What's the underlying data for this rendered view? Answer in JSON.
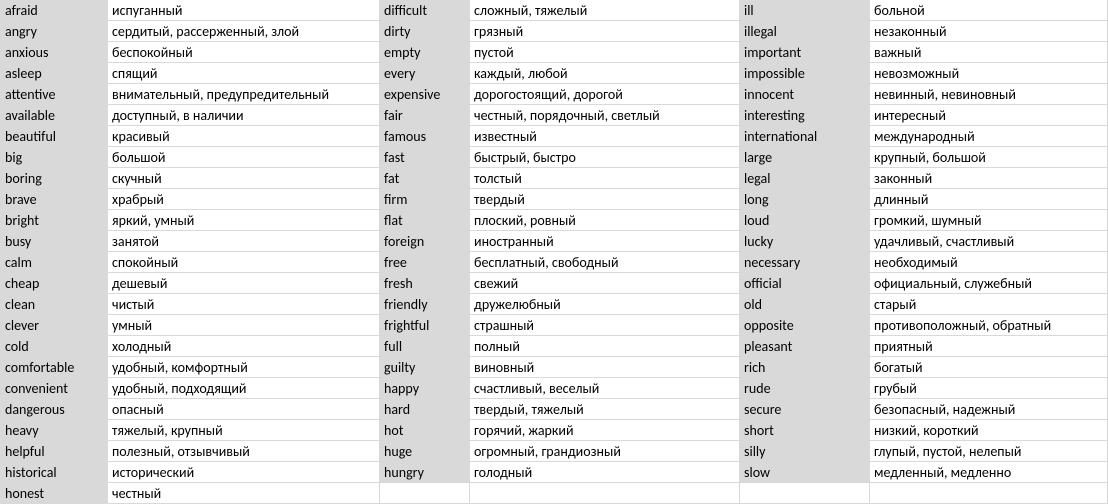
{
  "columns": [
    {
      "rows": [
        {
          "en": "afraid",
          "ru": "испуганный"
        },
        {
          "en": "angry",
          "ru": "сердитый, рассерженный, злой"
        },
        {
          "en": "anxious",
          "ru": "беспокойный"
        },
        {
          "en": "asleep",
          "ru": "спящий"
        },
        {
          "en": "attentive",
          "ru": "внимательный, предупредительный"
        },
        {
          "en": "available",
          "ru": "доступный, в наличии"
        },
        {
          "en": "beautiful",
          "ru": "красивый"
        },
        {
          "en": "big",
          "ru": "большой"
        },
        {
          "en": "boring",
          "ru": "скучный"
        },
        {
          "en": "brave",
          "ru": "храбрый"
        },
        {
          "en": "bright",
          "ru": "яркий, умный"
        },
        {
          "en": "busy",
          "ru": "занятой"
        },
        {
          "en": "calm",
          "ru": "спокойный"
        },
        {
          "en": "cheap",
          "ru": "дешевый"
        },
        {
          "en": "clean",
          "ru": "чистый"
        },
        {
          "en": "clever",
          "ru": "умный"
        },
        {
          "en": "cold",
          "ru": "холодный"
        },
        {
          "en": "comfortable",
          "ru": "удобный, комфортный"
        },
        {
          "en": "convenient",
          "ru": "удобный, подходящий"
        },
        {
          "en": "dangerous",
          "ru": "опасный"
        },
        {
          "en": "heavy",
          "ru": "тяжелый, крупный"
        },
        {
          "en": "helpful",
          "ru": "полезный, отзывчивый"
        },
        {
          "en": "historical",
          "ru": "исторический"
        },
        {
          "en": "honest",
          "ru": "честный"
        }
      ]
    },
    {
      "rows": [
        {
          "en": "difficult",
          "ru": "сложный, тяжелый"
        },
        {
          "en": "dirty",
          "ru": "грязный"
        },
        {
          "en": "empty",
          "ru": "пустой"
        },
        {
          "en": "every",
          "ru": "каждый, любой"
        },
        {
          "en": "expensive",
          "ru": "дорогостоящий, дорогой"
        },
        {
          "en": "fair",
          "ru": "честный, порядочный, светлый"
        },
        {
          "en": "famous",
          "ru": "известный"
        },
        {
          "en": "fast",
          "ru": "быстрый, быстро"
        },
        {
          "en": "fat",
          "ru": "толстый"
        },
        {
          "en": "firm",
          "ru": "твердый"
        },
        {
          "en": "flat",
          "ru": "плоский, ровный"
        },
        {
          "en": "foreign",
          "ru": "иностранный"
        },
        {
          "en": "free",
          "ru": "бесплатный, свободный"
        },
        {
          "en": "fresh",
          "ru": "свежий"
        },
        {
          "en": "friendly",
          "ru": "дружелюбный"
        },
        {
          "en": "frightful",
          "ru": "страшный"
        },
        {
          "en": "full",
          "ru": "полный"
        },
        {
          "en": "guilty",
          "ru": "виновный"
        },
        {
          "en": "happy",
          "ru": "счастливый, веселый"
        },
        {
          "en": "hard",
          "ru": "твердый, тяжелый"
        },
        {
          "en": "hot",
          "ru": "горячий, жаркий"
        },
        {
          "en": "huge",
          "ru": "огромный, грандиозный"
        },
        {
          "en": "hungry",
          "ru": "голодный"
        },
        {
          "en": "",
          "ru": ""
        }
      ]
    },
    {
      "rows": [
        {
          "en": "ill",
          "ru": "больной"
        },
        {
          "en": "illegal",
          "ru": "незаконный"
        },
        {
          "en": "important",
          "ru": "важный"
        },
        {
          "en": "impossible",
          "ru": "невозможный"
        },
        {
          "en": "innocent",
          "ru": "невинный, невиновный"
        },
        {
          "en": "interesting",
          "ru": "интересный"
        },
        {
          "en": "international",
          "ru": "международный"
        },
        {
          "en": "large",
          "ru": "крупный, большой"
        },
        {
          "en": "legal",
          "ru": "законный"
        },
        {
          "en": "long",
          "ru": "длинный"
        },
        {
          "en": "loud",
          "ru": "громкий, шумный"
        },
        {
          "en": "lucky",
          "ru": "удачливый, счастливый"
        },
        {
          "en": "necessary",
          "ru": "необходимый"
        },
        {
          "en": "official",
          "ru": "официальный, служебный"
        },
        {
          "en": "old",
          "ru": "старый"
        },
        {
          "en": "opposite",
          "ru": "противоположный, обратный"
        },
        {
          "en": "pleasant",
          "ru": "приятный"
        },
        {
          "en": "rich",
          "ru": "богатый"
        },
        {
          "en": "rude",
          "ru": "грубый"
        },
        {
          "en": "secure",
          "ru": "безопасный, надежный"
        },
        {
          "en": "short",
          "ru": "низкий, короткий"
        },
        {
          "en": "silly",
          "ru": "глупый, пустой, нелепый"
        },
        {
          "en": "slow",
          "ru": "медленный, медленно"
        },
        {
          "en": "",
          "ru": ""
        }
      ]
    }
  ]
}
